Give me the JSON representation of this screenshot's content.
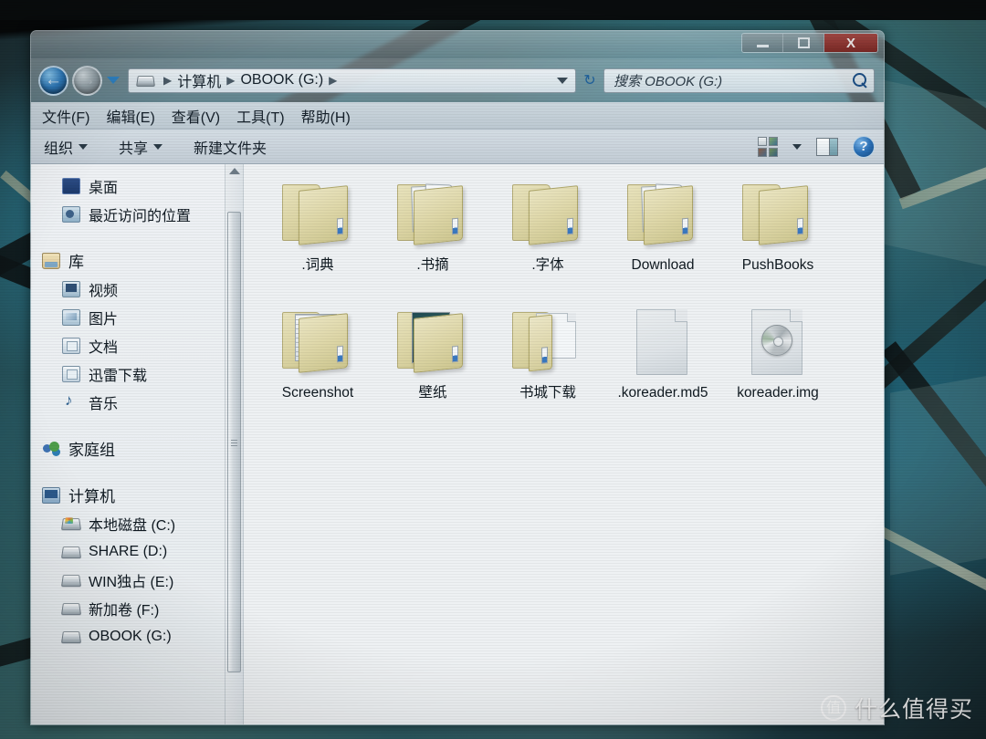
{
  "window": {
    "controls": {
      "minimize": "—",
      "maximize": "□",
      "close": "X"
    }
  },
  "nav": {
    "back_label": "←",
    "forward_label": "→",
    "recent_dropdown": "recent-pages-dropdown",
    "refresh_label": "↻",
    "breadcrumbs": [
      {
        "label": "计算机"
      },
      {
        "label": "OBOOK (G:)"
      }
    ]
  },
  "search": {
    "placeholder": "搜索 OBOOK (G:)",
    "value": ""
  },
  "menubar": {
    "items": [
      {
        "label": "文件(F)"
      },
      {
        "label": "编辑(E)"
      },
      {
        "label": "查看(V)"
      },
      {
        "label": "工具(T)"
      },
      {
        "label": "帮助(H)"
      }
    ]
  },
  "toolbar": {
    "organize_label": "组织",
    "share_label": "共享",
    "newfolder_label": "新建文件夹",
    "view_icon": "view-mode-icon",
    "view_dropdown": "view-dropdown-caret",
    "preview_pane_icon": "preview-pane-icon",
    "help_label": "?"
  },
  "sidebar": {
    "items": [
      {
        "label": "桌面",
        "icon": "desktop-icon",
        "level": "child"
      },
      {
        "label": "最近访问的位置",
        "icon": "recent-places-icon",
        "level": "child"
      },
      {
        "label": "库",
        "icon": "library-icon",
        "level": "group"
      },
      {
        "label": "视频",
        "icon": "videos-icon",
        "level": "child"
      },
      {
        "label": "图片",
        "icon": "pictures-icon",
        "level": "child"
      },
      {
        "label": "文档",
        "icon": "documents-icon",
        "level": "child"
      },
      {
        "label": "迅雷下载",
        "icon": "thunder-download-icon",
        "level": "child"
      },
      {
        "label": "音乐",
        "icon": "music-icon",
        "level": "child"
      },
      {
        "label": "家庭组",
        "icon": "homegroup-icon",
        "level": "group"
      },
      {
        "label": "计算机",
        "icon": "computer-icon",
        "level": "group"
      },
      {
        "label": "本地磁盘 (C:)",
        "icon": "windows-drive-icon",
        "level": "child"
      },
      {
        "label": "SHARE (D:)",
        "icon": "drive-icon",
        "level": "child"
      },
      {
        "label": "WIN独占 (E:)",
        "icon": "drive-icon",
        "level": "child"
      },
      {
        "label": "新加卷 (F:)",
        "icon": "drive-icon",
        "level": "child"
      },
      {
        "label": "OBOOK (G:)",
        "icon": "drive-icon",
        "level": "child"
      }
    ]
  },
  "content": {
    "items": [
      {
        "name": ".词典",
        "kind": "folder",
        "icon": "folder-icon"
      },
      {
        "name": ".书摘",
        "kind": "folder-docs",
        "icon": "folder-with-documents-icon"
      },
      {
        "name": ".字体",
        "kind": "folder",
        "icon": "folder-icon"
      },
      {
        "name": "Download",
        "kind": "folder-docs",
        "icon": "folder-with-documents-icon"
      },
      {
        "name": "PushBooks",
        "kind": "folder",
        "icon": "folder-icon"
      },
      {
        "name": "Screenshot",
        "kind": "folder-shots",
        "icon": "folder-with-screenshots-icon"
      },
      {
        "name": "壁纸",
        "kind": "folder-photo",
        "icon": "folder-with-photo-icon"
      },
      {
        "name": "书城下载",
        "kind": "folder-empty",
        "icon": "empty-folder-icon"
      },
      {
        "name": ".koreader.md5",
        "kind": "file",
        "icon": "blank-file-icon"
      },
      {
        "name": "koreader.img",
        "kind": "file-disc",
        "icon": "disc-image-file-icon"
      }
    ]
  },
  "cursor": {
    "state": "busy-working-ring"
  },
  "watermark": {
    "badge": "值",
    "text": "什么值得买"
  }
}
